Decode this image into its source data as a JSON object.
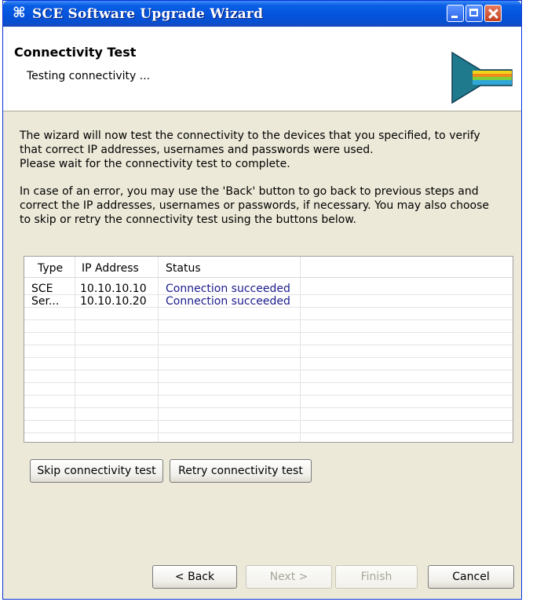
{
  "window": {
    "title": "SCE Software Upgrade Wizard",
    "icon": "app-glyph-icon"
  },
  "header": {
    "title": "Connectivity Test",
    "subtitle": "Testing connectivity ..."
  },
  "description": {
    "lines": [
      "The wizard will now test the connectivity to the devices that you specified, to verify",
      "that correct IP addresses, usernames and passwords were used.",
      "Please wait for the connectivity test to complete.",
      "In case of an error, you may use the 'Back' button to go back to previous steps and",
      "correct the IP addresses, usernames or passwords, if necessary. You may also choose",
      "to skip or retry the connectivity test using the buttons below."
    ]
  },
  "table": {
    "columns": [
      "Type",
      "IP Address",
      "Status"
    ],
    "rows": [
      {
        "type": "SCE",
        "ip": "10.10.10.10",
        "status": "Connection succeeded"
      },
      {
        "type": "Ser...",
        "ip": "10.10.10.20",
        "status": "Connection succeeded"
      }
    ]
  },
  "actions": {
    "skip": "Skip connectivity test",
    "retry": "Retry connectivity test"
  },
  "nav": {
    "back": "< Back",
    "next": "Next >",
    "finish": "Finish",
    "cancel": "Cancel"
  },
  "colors": {
    "titlebar": "#0453dc",
    "status_text": "#1a1a8c",
    "dialog_bg": "#ece9d8"
  }
}
